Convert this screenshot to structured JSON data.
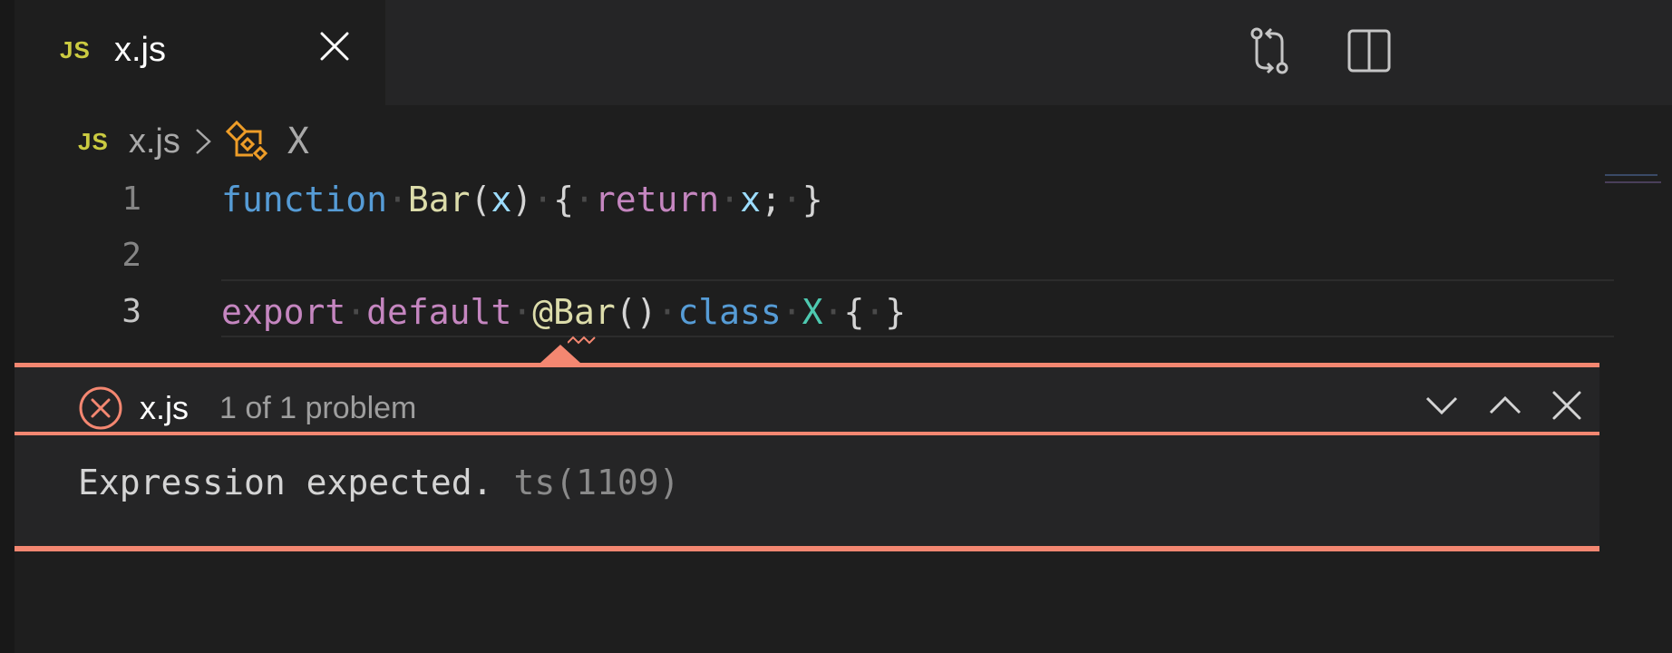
{
  "tab": {
    "badge": "JS",
    "label": "x.js",
    "active": true
  },
  "toolbar": {
    "compare_icon": "git-compare-icon",
    "split_icon": "split-editor-icon"
  },
  "breadcrumb": {
    "badge": "JS",
    "file": "x.js",
    "separator_icon": "chevron-right-icon",
    "symbol_icon": "class-symbol-icon",
    "symbol": "X"
  },
  "editor": {
    "lines": [
      {
        "number": "1",
        "tokens": [
          "function",
          "Bar",
          "x",
          "return",
          "x;"
        ]
      },
      {
        "number": "2",
        "tokens": []
      },
      {
        "number": "3",
        "tokens": [
          "export",
          "default",
          "@Bar",
          "class",
          "X"
        ]
      }
    ],
    "ln1": "1",
    "ln2": "2",
    "ln3": "3"
  },
  "problem": {
    "file": "x.js",
    "count": "1 of 1 problem",
    "message": "Expression expected.",
    "code": "ts(1109)",
    "severity_icon": "error-icon",
    "accent": "#f48771"
  },
  "colors": {
    "keyword_blue": "#569cd6",
    "keyword_purple": "#c586c0",
    "function": "#dcdcaa",
    "parameter": "#9cdcfe",
    "class": "#4ec9b0",
    "js_badge": "#cbcb41"
  }
}
